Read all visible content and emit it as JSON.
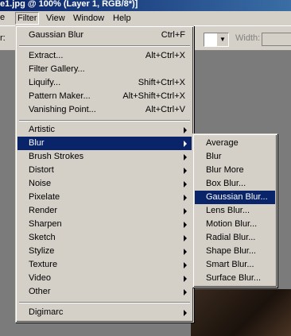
{
  "window": {
    "title": "e1.jpg @ 100% (Layer 1, RGB/8*)]"
  },
  "menubar": {
    "partial_left": "e",
    "items": [
      "Filter",
      "View",
      "Window",
      "Help"
    ]
  },
  "optionsbar": {
    "partial_left": "r:",
    "width_label": "Width:"
  },
  "filter_menu": {
    "group1": [
      {
        "label": "Gaussian Blur",
        "shortcut": "Ctrl+F"
      }
    ],
    "group2": [
      {
        "label": "Extract...",
        "shortcut": "Alt+Ctrl+X"
      },
      {
        "label": "Filter Gallery...",
        "shortcut": ""
      },
      {
        "label": "Liquify...",
        "shortcut": "Shift+Ctrl+X"
      },
      {
        "label": "Pattern Maker...",
        "shortcut": "Alt+Shift+Ctrl+X"
      },
      {
        "label": "Vanishing Point...",
        "shortcut": "Alt+Ctrl+V"
      }
    ],
    "group3": [
      {
        "label": "Artistic"
      },
      {
        "label": "Blur"
      },
      {
        "label": "Brush Strokes"
      },
      {
        "label": "Distort"
      },
      {
        "label": "Noise"
      },
      {
        "label": "Pixelate"
      },
      {
        "label": "Render"
      },
      {
        "label": "Sharpen"
      },
      {
        "label": "Sketch"
      },
      {
        "label": "Stylize"
      },
      {
        "label": "Texture"
      },
      {
        "label": "Video"
      },
      {
        "label": "Other"
      }
    ],
    "group4": [
      {
        "label": "Digimarc"
      }
    ],
    "highlighted": "Blur"
  },
  "blur_submenu": {
    "items": [
      "Average",
      "Blur",
      "Blur More",
      "Box Blur...",
      "Gaussian Blur...",
      "Lens Blur...",
      "Motion Blur...",
      "Radial Blur...",
      "Shape Blur...",
      "Smart Blur...",
      "Surface Blur..."
    ],
    "highlighted": "Gaussian Blur..."
  },
  "colors": {
    "menu_bg": "#d4d0c8",
    "highlight": "#0a246a",
    "title_gradient_start": "#0a246a",
    "canvas_bg": "#7b7b7b"
  }
}
